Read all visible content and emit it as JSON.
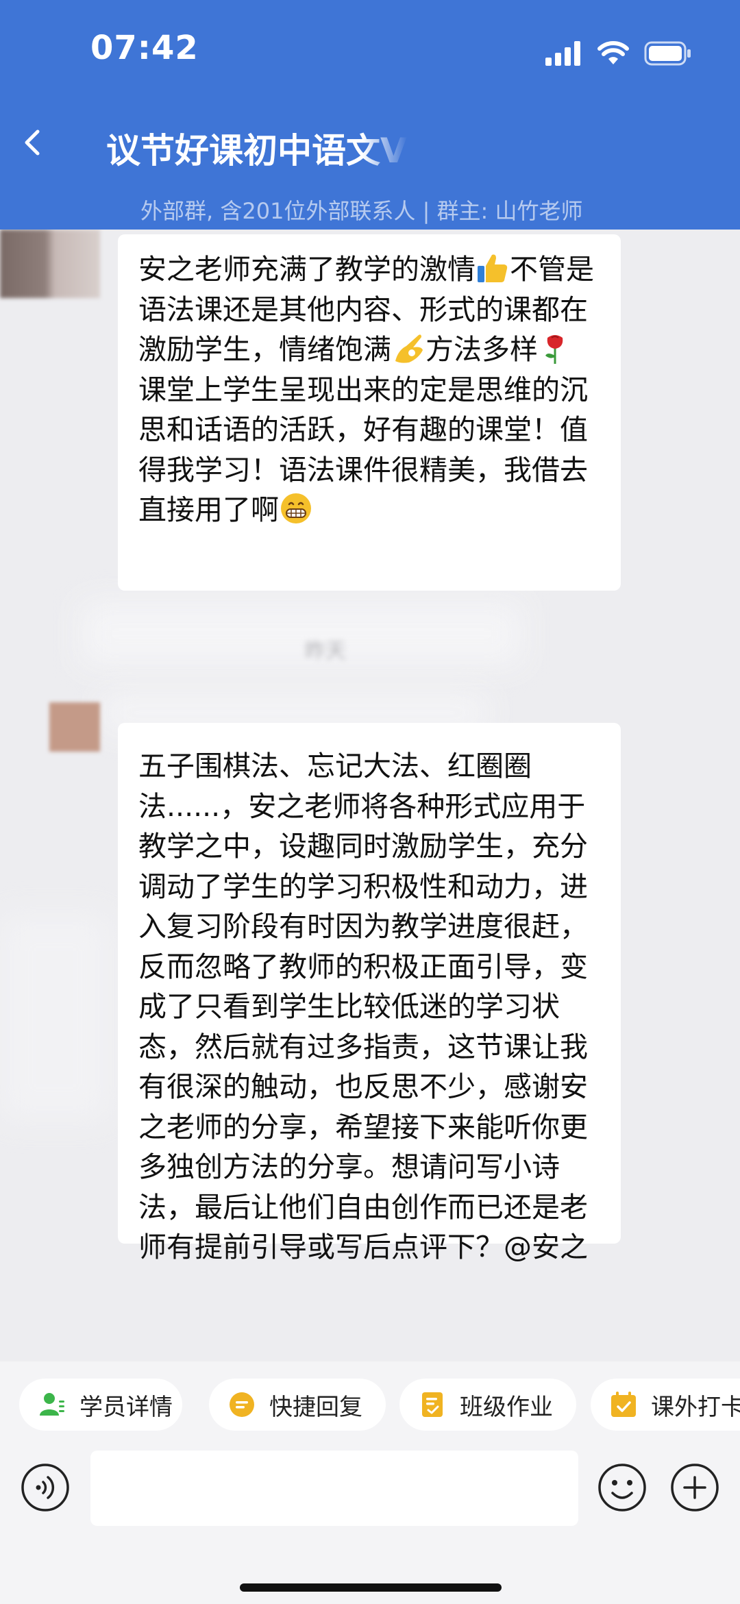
{
  "status_bar": {
    "time": "07:42",
    "icons": [
      "signal-icon",
      "wifi-icon",
      "battery-icon"
    ]
  },
  "header": {
    "title": "议节好课初中语文VI",
    "subtitle": "外部群, 含201位外部联系人 | 群主: 山竹老师"
  },
  "timestamp": "昨天",
  "messages": [
    {
      "segments": [
        {
          "t": "安之老师充满了教学的激情"
        },
        {
          "e": "thumbs-up-emoji"
        },
        {
          "t": "不管是语法课还是其他内容、形式的课都在激励学生，情绪饱满"
        },
        {
          "e": "ok-hand-emoji"
        },
        {
          "t": "方法多样"
        },
        {
          "e": "rose-emoji"
        },
        {
          "t": "课堂上学生呈现出来的定是思维的沉思和话语的活跃，好有趣的课堂！值得我学习！语法课件很精美，我借去直接用了啊"
        },
        {
          "e": "grinning-face-emoji"
        }
      ]
    },
    {
      "segments": [
        {
          "t": "五子围棋法、忘记大法、红圈圈法......，安之老师将各种形式应用于教学之中，设趣同时激励学生，充分调动了学生的学习积极性和动力，进入复习阶段有时因为教学进度很赶，反而忽略了教师的积极正面引导，变成了只看到学生比较低迷的学习状态，然后就有过多指责，这节课让我有很深的触动，也反思不少，感谢安之老师的分享，希望接下来能听你更多独创方法的分享。想请问写小诗法，最后让他们自由创作而已还是老师有提前引导或写后点评下？@安之"
        }
      ]
    }
  ],
  "quick_actions": [
    {
      "label": "学员详情",
      "icon": "student-detail-icon",
      "color": "#3cb54a"
    },
    {
      "label": "快捷回复",
      "icon": "quick-reply-icon",
      "color": "#f0b322"
    },
    {
      "label": "班级作业",
      "icon": "homework-icon",
      "color": "#f0b322"
    },
    {
      "label": "课外打卡",
      "icon": "checkin-icon",
      "color": "#f0b322"
    }
  ],
  "input": {
    "value": "",
    "placeholder": ""
  },
  "colors": {
    "header": "#3f75d6",
    "chat_background": "#ededf0",
    "bubble": "#ffffff",
    "accent_green": "#3cb54a",
    "accent_yellow": "#f0b322"
  }
}
